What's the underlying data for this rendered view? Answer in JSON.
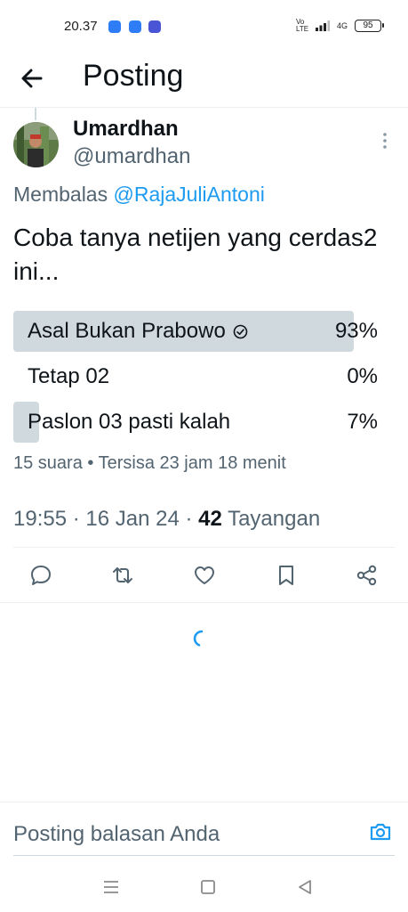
{
  "status_bar": {
    "time": "20.37",
    "network": "4G",
    "lte_label": "Vo LTE",
    "battery": "95"
  },
  "header": {
    "title": "Posting",
    "back_icon": "arrow-left-icon"
  },
  "tweet": {
    "author_name": "Umardhan",
    "author_handle": "@umardhan",
    "reply_prefix": "Membalas ",
    "reply_mention": "@RajaJuliAntoni",
    "text": "Coba tanya netijen yang cerdas2 ini...",
    "poll": {
      "options": [
        {
          "label": "Asal Bukan Prabowo",
          "percent_label": "93%",
          "percent": 93,
          "selected": true
        },
        {
          "label": "Tetap 02",
          "percent_label": "0%",
          "percent": 0,
          "selected": false
        },
        {
          "label": "Paslon 03 pasti kalah",
          "percent_label": "7%",
          "percent": 7,
          "selected": false
        }
      ],
      "meta": "15 suara • Tersisa 23 jam 18 menit"
    },
    "timestamp": "19:55 · 16 Jan 24 · ",
    "views_count": "42",
    "views_label": " Tayangan"
  },
  "actions": [
    "reply-icon",
    "retweet-icon",
    "like-icon",
    "bookmark-icon",
    "share-icon"
  ],
  "composer": {
    "placeholder": "Posting balasan Anda"
  },
  "colors": {
    "accent": "#1d9bf0",
    "text": "#0f1419",
    "muted": "#536471",
    "poll_bar": "#cfd9de"
  }
}
